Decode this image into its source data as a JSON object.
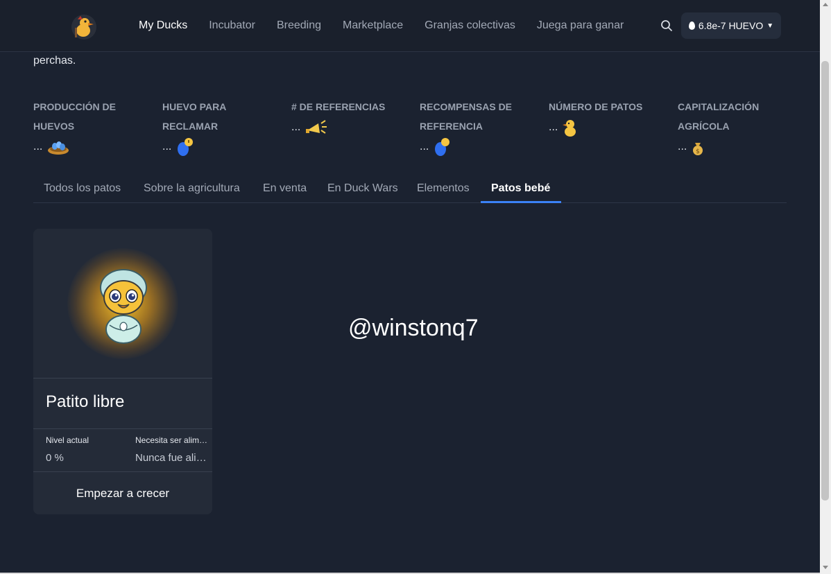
{
  "header": {
    "nav": [
      {
        "label": "My Ducks",
        "active": true
      },
      {
        "label": "Incubator"
      },
      {
        "label": "Breeding"
      },
      {
        "label": "Marketplace"
      },
      {
        "label": "Granjas colectivas"
      },
      {
        "label": "Juega para ganar"
      }
    ],
    "balance": "6.8e-7 HUEVO",
    "icons": {
      "logo": "duck-logo-icon",
      "search": "search-icon",
      "balance": "egg-icon",
      "dropdown": "chevron-down-icon"
    }
  },
  "intro_tail": "perchas.",
  "stats": [
    {
      "label": "PRODUCCIÓN DE HUEVOS",
      "value": "...",
      "icon": "egg-nest-icon"
    },
    {
      "label": "HUEVO PARA RECLAMAR",
      "value": "...",
      "icon": "blue-egg-clock-icon"
    },
    {
      "label": "# DE REFERENCIAS",
      "value": "...",
      "icon": "megaphone-icon"
    },
    {
      "label": "RECOMPENSAS DE REFERENCIA",
      "value": "...",
      "icon": "blue-egg-coin-icon"
    },
    {
      "label": "NÚMERO DE PATOS",
      "value": "...",
      "icon": "duck-icon"
    },
    {
      "label": "CAPITALIZACIÓN AGRÍCOLA",
      "value": "...",
      "icon": "money-bag-icon"
    }
  ],
  "tabs": [
    {
      "label": "Todos los patos"
    },
    {
      "label": "Sobre la agricultura"
    },
    {
      "label": "En venta"
    },
    {
      "label": "En Duck Wars"
    },
    {
      "label": "Elementos"
    },
    {
      "label": "Patos bebé",
      "active": true
    }
  ],
  "card": {
    "title": "Patito libre",
    "level_label": "Nivel actual",
    "level_value": "0 %",
    "feed_label": "Necesita ser alimentado",
    "feed_value": "Nunca fue alimentado",
    "button": "Empezar a crecer",
    "image_icon": "baby-duck-icon"
  },
  "watermark": "@winstonq7",
  "colors": {
    "accent": "#3b82f6",
    "background": "#1b2230",
    "card": "#242b38"
  }
}
